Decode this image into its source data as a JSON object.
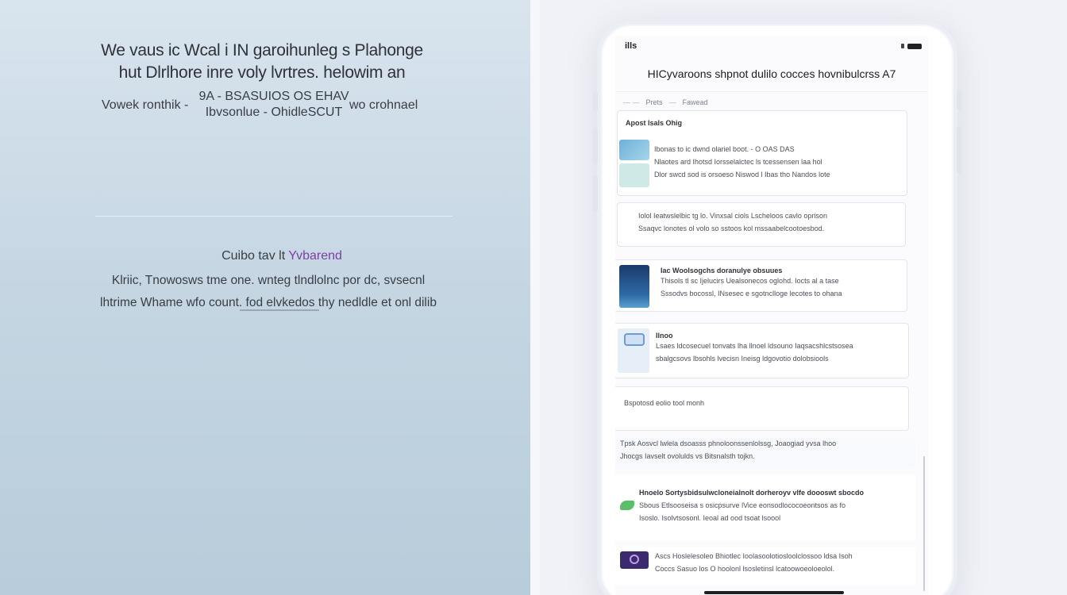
{
  "hero": {
    "headline_line1": "We vaus ic Wcal i IN garoihunleg s Plahonge",
    "headline_line2": "hut Dlrlhore inre voly lvrtres. helowim an",
    "meta_left": "Vowek ronthik -",
    "meta_center_line1": "9A - BSASUIOS OS EHAV",
    "meta_center_line2": "Ibvsonlue - OhidleSCUT",
    "meta_right": "wo crohnael",
    "sub_title_prefix": "Cuibo tav lt",
    "sub_title_accent": "Yvbarend",
    "sub_body_line1": "Klriic, Tnowosws tme one. wnteg tlndlolnc por dc, svsecnl",
    "sub_body_line2": "lhtrime Whame wfo count. fod elvkedos thy nedldle et onl dilib"
  },
  "phone": {
    "status_time": "ills",
    "app_title": "HICyvaroons shpnot dulilo cocces hovnibulcrss A7",
    "breadcrumb": [
      "Prets",
      "Fawead"
    ],
    "section_label": "Apost lsals Ohig",
    "cards": [
      {
        "lines": [
          "Ibonas to ic dwnd olariel boot. - O OAS DAS",
          "Nlaotes ard Ihotsd Iorsselalctec ls tcessensen laa hol",
          "Dlor swcd sod is orsoeso Niswod l Ibas tho Nandos lote"
        ]
      },
      {
        "lines": [
          "Iolol Ieatwslelbic tg lo. Vinxsal ciols Lscheloos cavlo oprison",
          "Ssaqvc lonotes ol volo so sstoos kol mssaabelcootoesbod."
        ]
      },
      {
        "label": "Iac Woolsogchs doranulye obsuues",
        "lines": [
          "Thisols tl sc Ijelucirs Uealsonecos oglohd. Iocts al a tase",
          "Sssodvs bocossl, INsesec e sgotnclloge lecotes to ohana"
        ]
      },
      {
        "label": "Ilnoo",
        "lines": [
          "Lsaes ldcosecuel tonvats lha llnoel ldsouno Iaqsacshlcstsosea",
          "sbalgcsovs lbsohls lvecisn Ineisg ldgovotio dolobsiools"
        ]
      },
      {
        "label": "Bspotosd eolio tool monh",
        "lines": []
      },
      {
        "lines": [
          "Tpsk Aosvcl lwlela dsoasss phnoloonssenlolssg, Joaogiad yvsa lhoo",
          "Jhocgs Iavselt ovolulds vs Bitsnalsth tojkn."
        ]
      },
      {
        "label": "Hnoelo Sortysbidsulwcloneialnolt dorheroyv vlfe doooswt sbocdo",
        "lines": [
          "Sbous Etlsooseisa s osicpsurve lVice eonsodlococoeontsos as fo",
          "Isoslo. Isolvtsosonl. Ieoal ad ood tsoat lsoool"
        ]
      },
      {
        "label": "Ascs Hoslelesoleo Bhiotlec Ioolasoolotiosloolclossoo ldsa Isoh",
        "lines": [
          "Coccs Sasuo los O hoolonl lsosletinsl lcatoowoeoloeolol."
        ]
      }
    ]
  },
  "colors": {
    "hero_bg": "#c6d7e3",
    "accent_purple": "#7b3fa0",
    "card_border": "#e3e5ec",
    "thumb_blue": "#7bbcd9",
    "thumb_dark": "#1b3a6b",
    "thumb_green": "#5bbf6a",
    "thumb_purple": "#3b2a6d"
  },
  "icons": [
    "photo-thumbnail-icon",
    "video-thumbnail-icon",
    "ios-gallery-icon",
    "green-leaf-icon",
    "ai-avatar-icon"
  ]
}
